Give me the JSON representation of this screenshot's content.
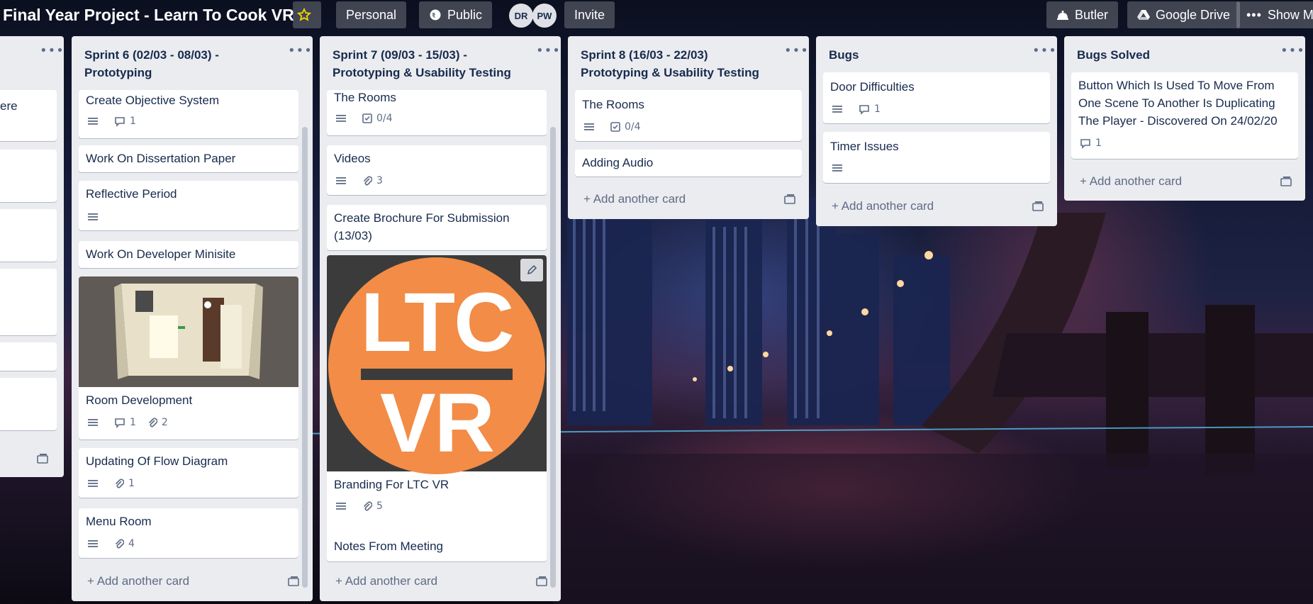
{
  "header": {
    "board_title": "Final Year Project - Learn To Cook VR",
    "personal_label": "Personal",
    "visibility_label": "Public",
    "avatars": [
      "DR",
      "PW"
    ],
    "invite_label": "Invite",
    "butler_label": "Butler",
    "drive_label": "Google Drive",
    "show_menu_label": "Show Me"
  },
  "lists": {
    "prev": {
      "cards": [
        "ere"
      ]
    },
    "sprint6": {
      "title_line1": "Sprint 6 (02/03 - 08/03) -",
      "title_line2": "Prototyping",
      "cards": [
        {
          "title": "Create Objective System",
          "comments": "1"
        },
        {
          "title": "Work On Dissertation Paper"
        },
        {
          "title": "Reflective Period"
        },
        {
          "title": "Work On Developer Minisite"
        },
        {
          "title": "Room Development",
          "comments": "1",
          "attachments": "2"
        },
        {
          "title": "Updating Of Flow Diagram",
          "attachments": "1"
        },
        {
          "title": "Menu Room",
          "attachments": "4"
        }
      ],
      "add_card": "Add another card"
    },
    "sprint7": {
      "title_line1": "Sprint 7 (09/03 - 15/03) -",
      "title_line2": "Prototyping & Usability Testing",
      "cards": [
        {
          "title": "The Rooms",
          "checklist": "0/4"
        },
        {
          "title": "Videos",
          "attachments": "3"
        },
        {
          "title_line1": "Create Brochure For Submission",
          "title_line2": "(13/03)"
        },
        {
          "title": "Branding For LTC VR",
          "attachments": "5",
          "cover_line1": "LTC",
          "cover_line2": "VR"
        },
        {
          "title": "Notes From Meeting"
        }
      ],
      "add_card": "Add another card"
    },
    "sprint8": {
      "title_line1": "Sprint 8 (16/03 - 22/03)",
      "title_line2": "Prototyping & Usability Testing",
      "cards": [
        {
          "title": "The Rooms",
          "checklist": "0/4"
        },
        {
          "title": "Adding Audio"
        }
      ],
      "add_card": "Add another card"
    },
    "bugs": {
      "title": "Bugs",
      "cards": [
        {
          "title": "Door Difficulties",
          "comments": "1"
        },
        {
          "title": "Timer Issues"
        }
      ],
      "add_card": "Add another card"
    },
    "bugs_solved": {
      "title": "Bugs Solved",
      "cards": [
        {
          "line1": "Button Which Is Used To Move From",
          "line2": "One Scene To Another Is Duplicating",
          "line3": "The Player - Discovered On 24/02/20",
          "comments": "1"
        }
      ],
      "add_card": "Add another card"
    }
  },
  "colors": {
    "list_bg": "#ebecf0",
    "card_bg": "#ffffff",
    "text": "#172b4d",
    "muted": "#5e6c84",
    "logo_orange": "#f28c46",
    "logo_dark": "#3b3b3b",
    "star": "#f2d600"
  }
}
